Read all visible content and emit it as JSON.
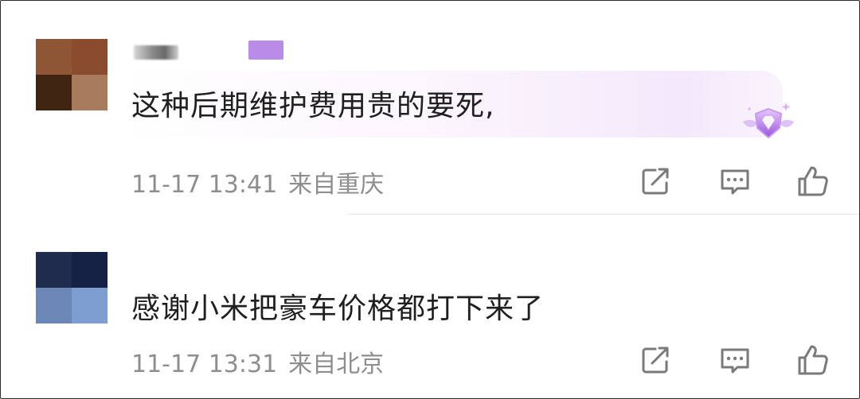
{
  "comments": [
    {
      "username_visible": ",",
      "text": "这种后期维护费用贵的要死,",
      "time": "11-17 13:41",
      "location": "来自重庆",
      "avatar_colors": [
        "#8e5634",
        "#8a4b2e",
        "#3f2412",
        "#a87a5e"
      ],
      "badge_color": "#b98ce8",
      "has_vip_badge": true,
      "icons": [
        "share-icon",
        "reply-icon",
        "like-icon"
      ]
    },
    {
      "text": "感谢小米把豪车价格都打下来了",
      "time": "11-17 13:31",
      "location": "来自北京",
      "avatar_colors": [
        "#1f2c4e",
        "#142044",
        "#6b87b8",
        "#7e9ed2"
      ],
      "icons": [
        "share-icon",
        "reply-icon",
        "like-icon"
      ]
    }
  ],
  "colors": {
    "meta_text": "#8e8e8e",
    "body_text": "#1f1f1f",
    "icon_stroke": "#7a7a7a",
    "vip_purple": "#a46be0"
  }
}
